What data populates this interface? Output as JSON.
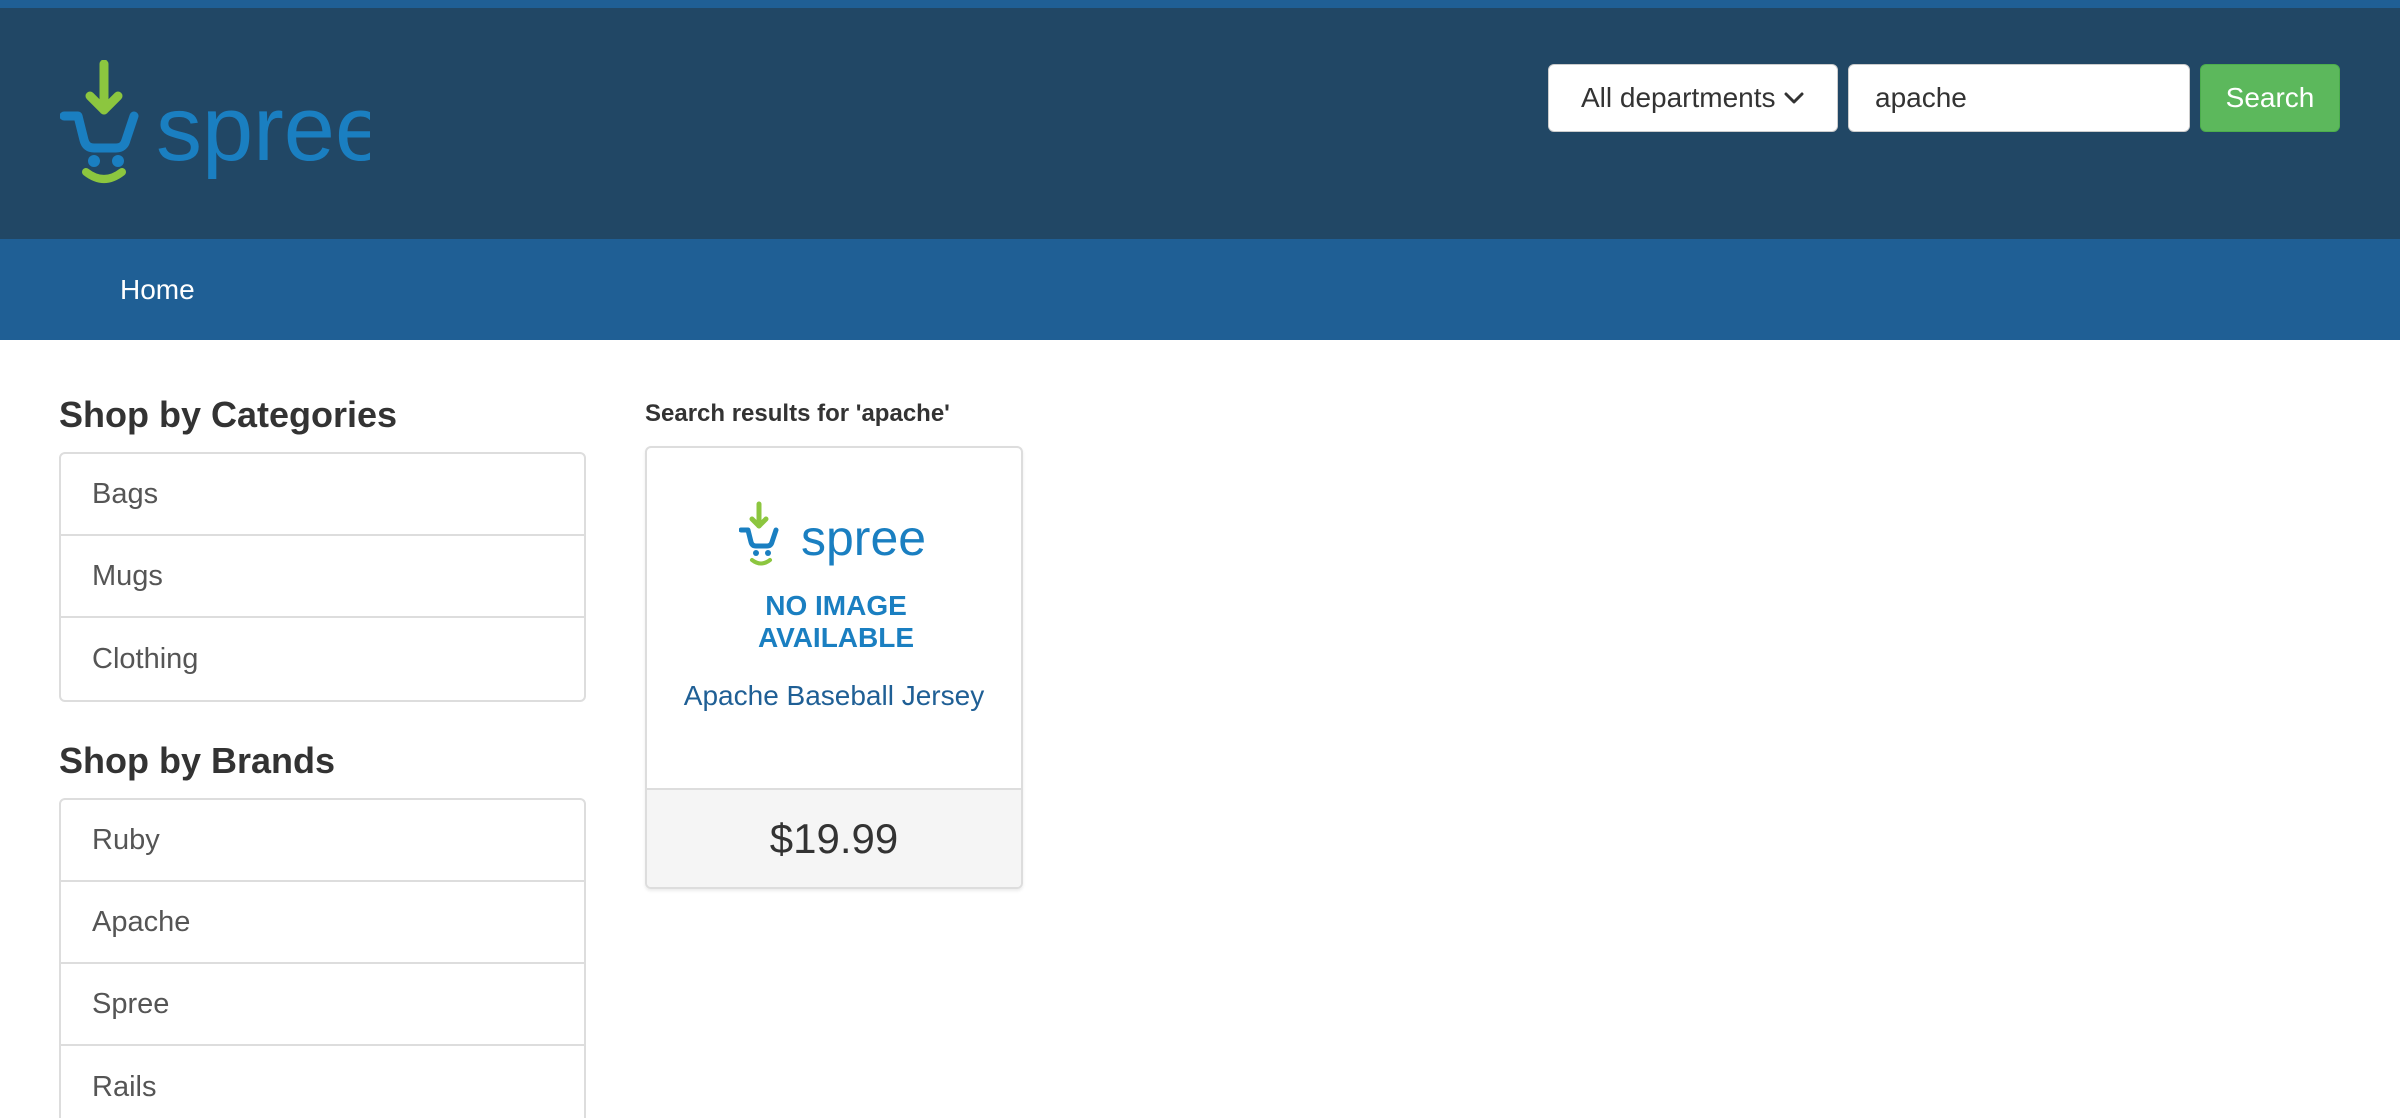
{
  "header": {
    "logo_text": "spree",
    "department_select": {
      "selected": "All departments"
    },
    "search": {
      "value": "apache",
      "button_label": "Search"
    }
  },
  "nav": {
    "home_label": "Home"
  },
  "sidebar": {
    "categories": {
      "heading": "Shop by Categories",
      "items": [
        {
          "label": "Bags"
        },
        {
          "label": "Mugs"
        },
        {
          "label": "Clothing"
        }
      ]
    },
    "brands": {
      "heading": "Shop by Brands",
      "items": [
        {
          "label": "Ruby"
        },
        {
          "label": "Apache"
        },
        {
          "label": "Spree"
        },
        {
          "label": "Rails"
        }
      ]
    }
  },
  "results": {
    "heading": "Search results for 'apache'",
    "products": [
      {
        "image_logo_text": "spree",
        "image_text_line1": "NO IMAGE",
        "image_text_line2": "AVAILABLE",
        "name": "Apache Baseball Jersey",
        "price": "$19.99"
      }
    ]
  },
  "colors": {
    "header_bg": "#214765",
    "nav_bg": "#1f5f95",
    "search_button": "#5cb85c",
    "logo_blue": "#1a7fc1",
    "logo_green": "#8cc63f",
    "link_blue": "#1f5f95"
  }
}
